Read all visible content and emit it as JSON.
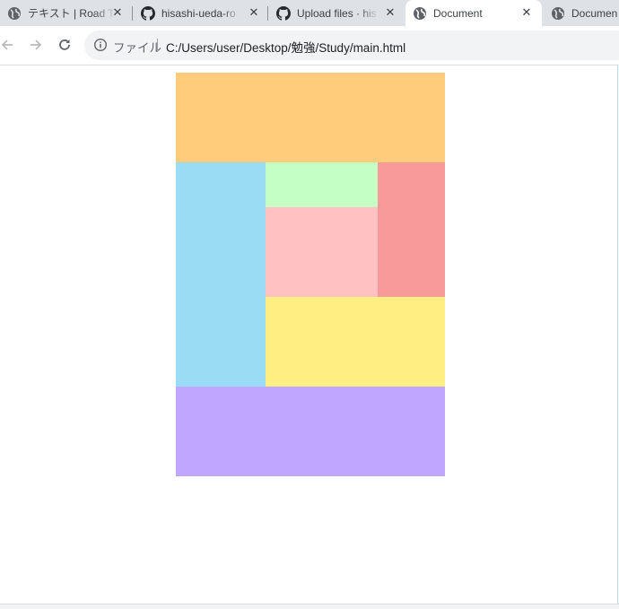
{
  "browser": {
    "tabs": [
      {
        "title": "テキスト | Road To",
        "favicon": "globe-icon",
        "close": "✕",
        "active": false
      },
      {
        "title": "hisashi-ueda-ro",
        "favicon": "github-icon",
        "close": "✕",
        "active": false
      },
      {
        "title": "Upload files · his",
        "favicon": "github-icon",
        "close": "✕",
        "active": false
      },
      {
        "title": "Document",
        "favicon": "globe-icon",
        "close": "✕",
        "active": true
      },
      {
        "title": "Documen",
        "favicon": "globe-icon",
        "close": "",
        "active": false
      }
    ],
    "toolbar": {
      "back_icon": "arrow-left-icon",
      "forward_icon": "arrow-right-icon",
      "reload_icon": "reload-icon",
      "site_info_icon": "info-circle-icon",
      "scheme_label": "ファイル",
      "url": "C:/Users/user/Desktop/勉強/Study/main.html"
    }
  },
  "page": {
    "background": "#ffffff",
    "layout_boxes": [
      {
        "name": "header-box",
        "color": "#ffcc7c"
      },
      {
        "name": "left-column-box",
        "color": "#9adcf4"
      },
      {
        "name": "top-middle-box",
        "color": "#c4ffc6"
      },
      {
        "name": "right-column-box",
        "color": "#f79a99"
      },
      {
        "name": "center-box",
        "color": "#ffc1c2"
      },
      {
        "name": "lower-middle-box",
        "color": "#ffef82"
      },
      {
        "name": "footer-box",
        "color": "#c1a6ff"
      }
    ]
  }
}
